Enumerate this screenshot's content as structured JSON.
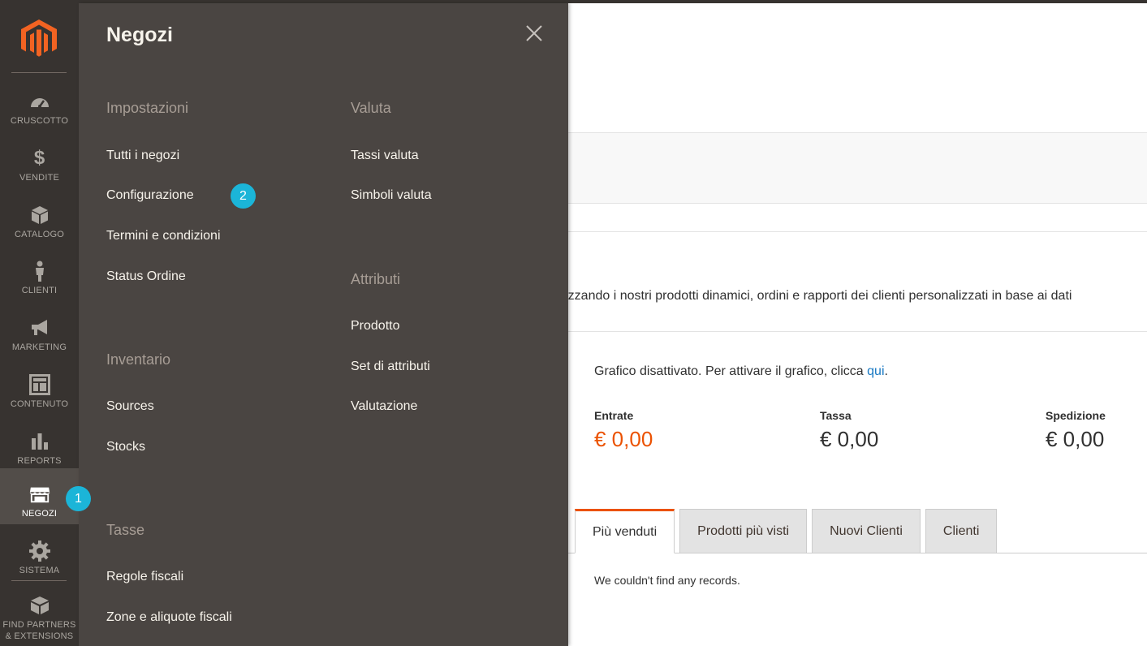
{
  "sidebar": {
    "items": [
      {
        "label": "CRUSCOTTO",
        "icon": "dashboard-icon"
      },
      {
        "label": "VENDITE",
        "icon": "dollar-icon"
      },
      {
        "label": "CATALOGO",
        "icon": "box-icon"
      },
      {
        "label": "CLIENTI",
        "icon": "person-icon"
      },
      {
        "label": "MARKETING",
        "icon": "megaphone-icon"
      },
      {
        "label": "CONTENUTO",
        "icon": "layout-icon"
      },
      {
        "label": "REPORTS",
        "icon": "bar-chart-icon"
      },
      {
        "label": "NEGOZI",
        "icon": "store-icon",
        "active": true
      },
      {
        "label": "SISTEMA",
        "icon": "gear-icon"
      },
      {
        "label": "FIND PARTNERS & EXTENSIONS",
        "icon": "blocks-icon"
      }
    ]
  },
  "flyout": {
    "title": "Negozi",
    "columns": [
      {
        "sections": [
          {
            "heading": "Impostazioni",
            "links": [
              "Tutti i negozi",
              "Configurazione",
              "Termini e condizioni",
              "Status Ordine"
            ]
          },
          {
            "heading": "Inventario",
            "links": [
              "Sources",
              "Stocks"
            ]
          },
          {
            "heading": "Tasse",
            "links": [
              "Regole fiscali",
              "Zone e aliquote fiscali"
            ]
          }
        ]
      },
      {
        "sections": [
          {
            "heading": "Valuta",
            "links": [
              "Tassi valuta",
              "Simboli valuta"
            ]
          },
          {
            "heading": "Attributi",
            "links": [
              "Prodotto",
              "Set di attributi",
              "Valutazione"
            ]
          }
        ]
      }
    ]
  },
  "badges": [
    "1",
    "2"
  ],
  "dashboard": {
    "intro_text": "one del tuo business, utilizzando i nostri prodotti dinamici, ordini e rapporti dei clienti personalizzati in base ai dati",
    "chart_notice": "Grafico disattivato. Per attivare il grafico, clicca",
    "chart_notice_link": "qui",
    "totals": [
      {
        "label": "Entrate",
        "value": "€ 0,00"
      },
      {
        "label": "Tassa",
        "value": "€ 0,00"
      },
      {
        "label": "Spedizione",
        "value": "€ 0,00"
      }
    ],
    "tabs": [
      "Più venduti",
      "Prodotti più visti",
      "Nuovi Clienti",
      "Clienti"
    ],
    "no_records": "We couldn't find any records."
  },
  "colors": {
    "sidebar_bg": "#373330",
    "flyout_bg": "#4a4542",
    "accent": "#eb5202",
    "badge": "#1bb5d8",
    "link": "#1979c3"
  }
}
